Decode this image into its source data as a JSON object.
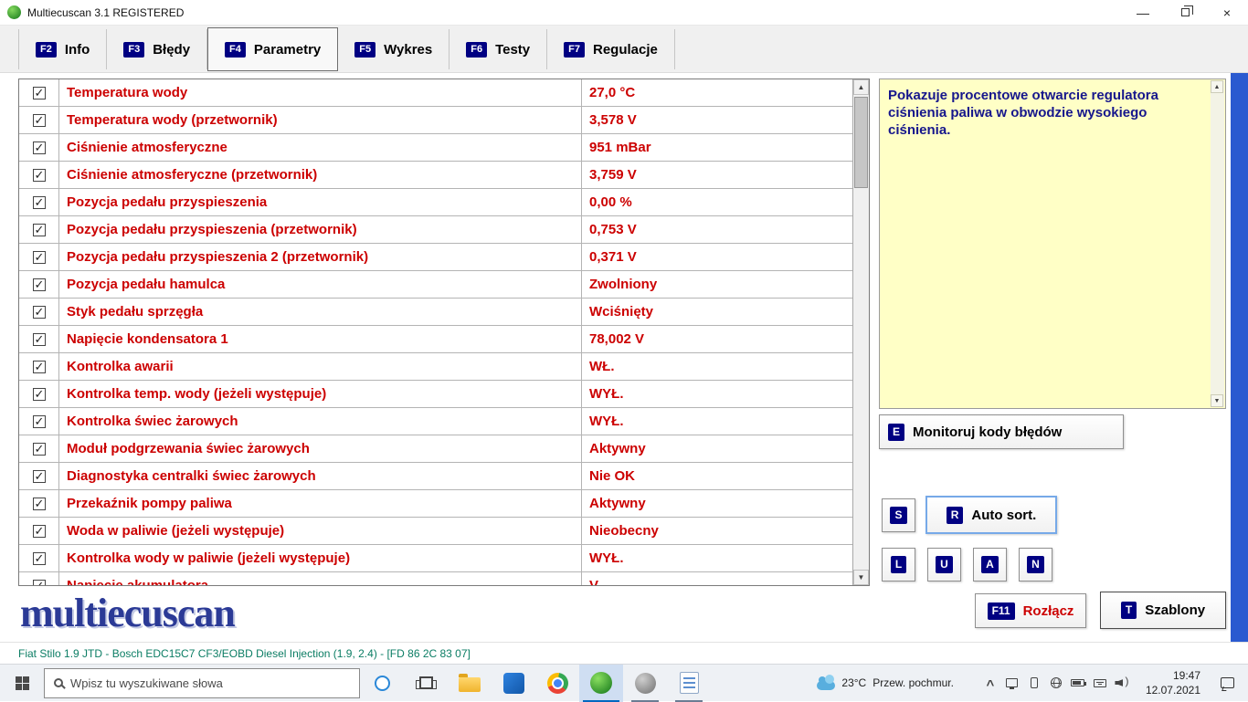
{
  "window": {
    "title": "Multiecuscan 3.1 REGISTERED"
  },
  "tabs": [
    {
      "id": "info",
      "key": "F2",
      "label": "Info",
      "active": false
    },
    {
      "id": "bledy",
      "key": "F3",
      "label": "Błędy",
      "active": false
    },
    {
      "id": "parametry",
      "key": "F4",
      "label": "Parametry",
      "active": true
    },
    {
      "id": "wykres",
      "key": "F5",
      "label": "Wykres",
      "active": false
    },
    {
      "id": "testy",
      "key": "F6",
      "label": "Testy",
      "active": false
    },
    {
      "id": "regulacje",
      "key": "F7",
      "label": "Regulacje",
      "active": false
    }
  ],
  "parameters": {
    "rows": [
      {
        "checked": true,
        "name": "Temperatura wody",
        "value": "27,0 °C"
      },
      {
        "checked": true,
        "name": "Temperatura wody (przetwornik)",
        "value": "3,578 V"
      },
      {
        "checked": true,
        "name": "Ciśnienie atmosferyczne",
        "value": "951 mBar"
      },
      {
        "checked": true,
        "name": "Ciśnienie atmosferyczne (przetwornik)",
        "value": "3,759 V"
      },
      {
        "checked": true,
        "name": "Pozycja pedału przyspieszenia",
        "value": "0,00 %"
      },
      {
        "checked": true,
        "name": "Pozycja pedału przyspieszenia (przetwornik)",
        "value": "0,753 V"
      },
      {
        "checked": true,
        "name": "Pozycja pedału przyspieszenia 2 (przetwornik)",
        "value": "0,371 V"
      },
      {
        "checked": true,
        "name": "Pozycja pedału hamulca",
        "value": "Zwolniony"
      },
      {
        "checked": true,
        "name": "Styk pedału sprzęgła",
        "value": "Wciśnięty"
      },
      {
        "checked": true,
        "name": "Napięcie kondensatora 1",
        "value": "78,002 V"
      },
      {
        "checked": true,
        "name": "Kontrolka awarii",
        "value": "WŁ."
      },
      {
        "checked": true,
        "name": "Kontrolka temp. wody (jeżeli występuje)",
        "value": "WYŁ."
      },
      {
        "checked": true,
        "name": "Kontrolka świec żarowych",
        "value": "WYŁ."
      },
      {
        "checked": true,
        "name": "Moduł podgrzewania świec żarowych",
        "value": "Aktywny"
      },
      {
        "checked": true,
        "name": "Diagnostyka centralki świec żarowych",
        "value": "Nie OK"
      },
      {
        "checked": true,
        "name": "Przekaźnik pompy paliwa",
        "value": "Aktywny"
      },
      {
        "checked": true,
        "name": "Woda w paliwie (jeżeli występuje)",
        "value": "Nieobecny"
      },
      {
        "checked": true,
        "name": "Kontrolka wody w paliwie (jeżeli występuje)",
        "value": "WYŁ."
      },
      {
        "checked": true,
        "name": "Napięcie akumulatora",
        "value": "V"
      }
    ]
  },
  "info_panel": {
    "text": "Pokazuje procentowe otwarcie regulatora ciśnienia paliwa w obwodzie wysokiego ciśnienia."
  },
  "side_buttons": {
    "monitor_key": "E",
    "monitor_label": "Monitoruj kody błędów",
    "sort_s_key": "S",
    "auto_sort_key": "R",
    "auto_sort_label": "Auto sort.",
    "extra_keys": [
      "L",
      "U",
      "A",
      "N"
    ]
  },
  "footer": {
    "logo": "multiecuscan",
    "disconnect_key": "F11",
    "disconnect_label": "Rozłącz",
    "templates_key": "T",
    "templates_label": "Szablony"
  },
  "status_bar": {
    "text": "Fiat Stilo 1.9 JTD - Bosch EDC15C7 CF3/EOBD Diesel Injection (1.9, 2.4) - [FD 86 2C 83 07]"
  },
  "taskbar": {
    "search_placeholder": "Wpisz tu wyszukiwane słowa",
    "weather_temp": "23°C",
    "weather_desc": "Przew. pochmur.",
    "time": "19:47",
    "date": "12.07.2021",
    "app_icons": [
      {
        "name": "file-explorer-icon",
        "open": false,
        "active": false
      },
      {
        "name": "blue-app-icon",
        "open": false,
        "active": false
      },
      {
        "name": "chrome-icon",
        "open": false,
        "active": false
      },
      {
        "name": "multiecuscan-icon",
        "open": true,
        "active": true
      },
      {
        "name": "gray-app-icon",
        "open": true,
        "active": false
      },
      {
        "name": "document-app-icon",
        "open": true,
        "active": false
      }
    ],
    "tray_icons": [
      "hidden-icons-chevron",
      "display-icon",
      "phone-icon",
      "network-globe-icon",
      "battery-icon",
      "keyboard-icon",
      "volume-icon"
    ]
  },
  "colors": {
    "param_red": "#cc0000",
    "badge_navy": "#000082",
    "info_bg": "#ffffc6",
    "info_text": "#16168c",
    "logo_blue": "#2b3a96",
    "status_green": "#0b7d64",
    "side_strip_blue": "#2a5ad0"
  }
}
